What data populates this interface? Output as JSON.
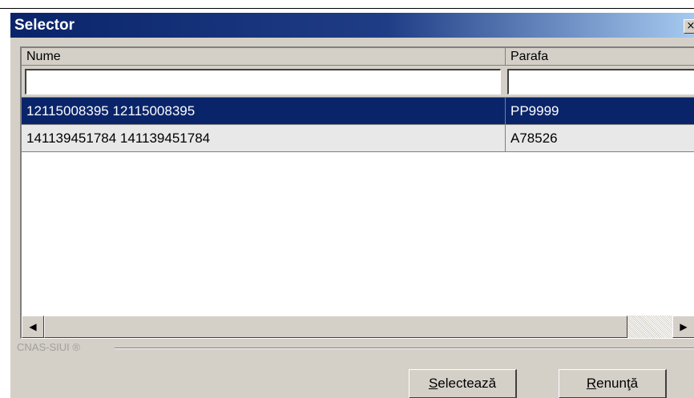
{
  "window": {
    "title": "Selector",
    "close_glyph": "×"
  },
  "grid": {
    "columns": [
      {
        "key": "nume",
        "label": "Nume"
      },
      {
        "key": "parafa",
        "label": "Parafa"
      }
    ],
    "filters": {
      "nume": "",
      "parafa": ""
    },
    "rows": [
      {
        "nume": "12115008395 12115008395",
        "parafa": "PP9999",
        "selected": true
      },
      {
        "nume": "141139451784 141139451784",
        "parafa": "A78526",
        "selected": false
      }
    ]
  },
  "scrollbar": {
    "left_arrow": "◀",
    "right_arrow": "▶"
  },
  "footer": {
    "brand": "CNAS-SIUI ®",
    "select_accel": "S",
    "select_rest": "electează",
    "cancel_accel": "R",
    "cancel_rest": "enunţă"
  },
  "colors": {
    "title_bar": "#0a246a",
    "selection": "#0a246a",
    "face": "#d4d0c8"
  },
  "icons": [
    "close-icon",
    "scroll-left-icon",
    "scroll-right-icon"
  ]
}
